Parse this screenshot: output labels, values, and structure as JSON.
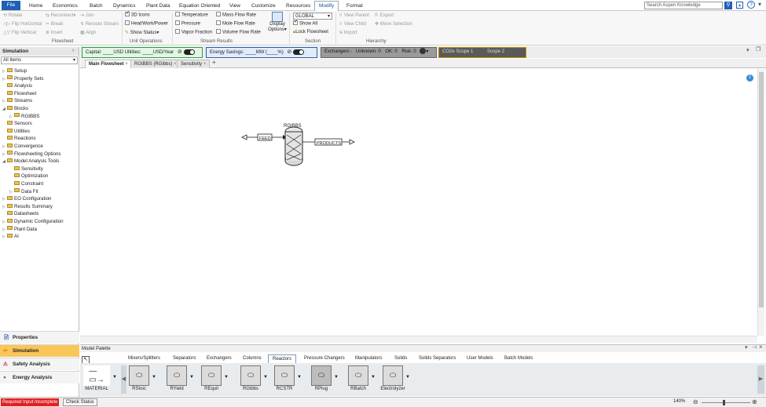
{
  "menu": {
    "file": "File",
    "items": [
      "Home",
      "Economics",
      "Batch",
      "Dynamics",
      "Plant Data",
      "Equation Oriented",
      "View",
      "Customize",
      "Resources",
      "Modify",
      "Format"
    ],
    "search_placeholder": "Search Aspen Knowledge"
  },
  "ribbon": {
    "flowsheet": {
      "rotate": "Rotate",
      "reconnect": "Reconnect",
      "join": "Join",
      "flip_horizontal": "Flip Horizontal",
      "break": "Break",
      "reroute": "Reroute Stream",
      "flip_vertical": "Flip Vertical",
      "insert": "Insert",
      "align": "Align",
      "group_label": "Flowsheet"
    },
    "unit_operations": {
      "icons_3d": "3D Icons",
      "heat_work_power": "Heat/Work/Power",
      "show_status": "Show Status",
      "group_label": "Unit Operations"
    },
    "stream_results": {
      "temperature": "Temperature",
      "pressure": "Pressure",
      "vapor_fraction": "Vapor Fraction",
      "mass_flow": "Mass Flow Rate",
      "mole_flow": "Mole Flow Rate",
      "volume_flow": "Volume Flow Rate",
      "display_options_1": "Display",
      "display_options_2": "Options",
      "group_label": "Stream Results"
    },
    "section": {
      "dropdown_value": "GLOBAL",
      "show_all": "Show All",
      "lock_flowsheet": "Lock Flowsheet",
      "group_label": "Section"
    },
    "hierarchy": {
      "view_parent": "View Parent",
      "export": "Export",
      "view_child": "View Child",
      "move_selection": "Move Selection",
      "import": "Import",
      "group_label": "Hierarchy"
    }
  },
  "status_panels": {
    "capital": "Capital: ____USD  Utilities: ____USD/Year",
    "energy": "Energy Savings: ____MW  (____%)",
    "exchangers_label": "Exchangers -",
    "unknown": "Unknown: 0",
    "ok": "OK: 0",
    "risk": "Risk: 0",
    "co2": "CO2e Scope 1",
    "scope2": "Scope 2"
  },
  "sidebar": {
    "title": "Simulation",
    "filter": "All Items",
    "items": [
      {
        "label": "Setup",
        "indent": 0,
        "exp": "▷"
      },
      {
        "label": "Property Sets",
        "indent": 0,
        "exp": "▷"
      },
      {
        "label": "Analysis",
        "indent": 0,
        "exp": ""
      },
      {
        "label": "Flowsheet",
        "indent": 0,
        "exp": ""
      },
      {
        "label": "Streams",
        "indent": 0,
        "exp": "▷"
      },
      {
        "label": "Blocks",
        "indent": 0,
        "exp": "◢"
      },
      {
        "label": "RGIBBS",
        "indent": 1,
        "exp": "▷"
      },
      {
        "label": "Sensors",
        "indent": 0,
        "exp": ""
      },
      {
        "label": "Utilities",
        "indent": 0,
        "exp": ""
      },
      {
        "label": "Reactions",
        "indent": 0,
        "exp": ""
      },
      {
        "label": "Convergence",
        "indent": 0,
        "exp": "▷"
      },
      {
        "label": "Flowsheeting Options",
        "indent": 0,
        "exp": "▷"
      },
      {
        "label": "Model Analysis Tools",
        "indent": 0,
        "exp": "◢"
      },
      {
        "label": "Sensitivity",
        "indent": 1,
        "exp": ""
      },
      {
        "label": "Optimization",
        "indent": 1,
        "exp": ""
      },
      {
        "label": "Constraint",
        "indent": 1,
        "exp": ""
      },
      {
        "label": "Data Fit",
        "indent": 1,
        "exp": "▷"
      },
      {
        "label": "EO Configuration",
        "indent": 0,
        "exp": "▷"
      },
      {
        "label": "Results Summary",
        "indent": 0,
        "exp": "▷"
      },
      {
        "label": "Datasheets",
        "indent": 0,
        "exp": ""
      },
      {
        "label": "Dynamic Configuration",
        "indent": 0,
        "exp": "▷"
      },
      {
        "label": "Plant Data",
        "indent": 0,
        "exp": "▷"
      },
      {
        "label": "AI",
        "indent": 0,
        "exp": "▷"
      }
    ],
    "nav": [
      "Properties",
      "Simulation",
      "Safety Analysis",
      "Energy Analysis"
    ]
  },
  "doc_tabs": [
    "Main Flowsheet",
    "RGIBBS (RGibbs)",
    "Sensitivity"
  ],
  "flowsheet": {
    "block_label": "RGIBBS",
    "feed": "FEED",
    "products": "PRODUCTS"
  },
  "palette": {
    "title": "Model Palette",
    "tabs": [
      "Mixers/Splitters",
      "Separators",
      "Exchangers",
      "Columns",
      "Reactors",
      "Pressure Changers",
      "Manipulators",
      "Solids",
      "Solids Separators",
      "User Models",
      "Batch Models"
    ],
    "active_tab": "Reactors",
    "models": [
      "MATERIAL",
      "RStoic",
      "RYield",
      "REquil",
      "RGibbs",
      "RCSTR",
      "RPlug",
      "RBatch",
      "Electrolyzer"
    ]
  },
  "statusbar": {
    "required": "Required Input Incomplete",
    "check": "Check Status",
    "zoom": "140%"
  },
  "colors": {
    "accent": "#1f5fb4",
    "capital_border": "#2e9e3e",
    "energy_border": "#2a5fb0",
    "exch_bg": "#8c8c8c",
    "co2_bg": "#4a4a4a",
    "required_bg": "#e02020"
  }
}
